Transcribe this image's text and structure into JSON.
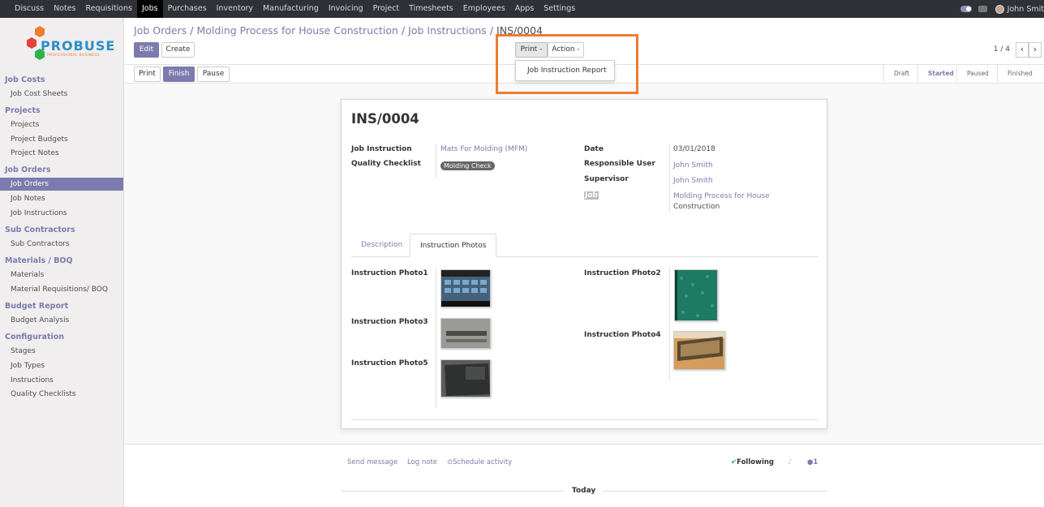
{
  "topnav": {
    "menu": [
      "Discuss",
      "Notes",
      "Requisitions",
      "Jobs",
      "Purchases",
      "Inventory",
      "Manufacturing",
      "Invoicing",
      "Project",
      "Timesheets",
      "Employees",
      "Apps",
      "Settings"
    ],
    "active": "Jobs",
    "user": "John Smit"
  },
  "logo": {
    "text": "PROBUSE",
    "tagline": "PROFESSIONAL BUSINESS"
  },
  "sidebar": {
    "sections": [
      {
        "title": "Job Costs",
        "items": [
          "Job Cost Sheets"
        ]
      },
      {
        "title": "Projects",
        "items": [
          "Projects",
          "Project Budgets",
          "Project Notes"
        ]
      },
      {
        "title": "Job Orders",
        "items": [
          "Job Orders",
          "Job Notes",
          "Job Instructions"
        ]
      },
      {
        "title": "Sub Contractors",
        "items": [
          "Sub Contractors"
        ]
      },
      {
        "title": "Materials / BOQ",
        "items": [
          "Materials",
          "Material Requisitions/ BOQ"
        ]
      },
      {
        "title": "Budget Report",
        "items": [
          "Budget Analysis"
        ]
      },
      {
        "title": "Configuration",
        "items": [
          "Stages",
          "Job Types",
          "Instructions",
          "Quality Checklists"
        ]
      }
    ],
    "active_item": "Job Orders"
  },
  "breadcrumb": {
    "items": [
      "Job Orders",
      "Molding Process for House Construction",
      "Job Instructions"
    ],
    "current": "INS/0004",
    "sep": "/"
  },
  "buttons": {
    "edit": "Edit",
    "create": "Create",
    "print": "Print -",
    "action": "Action -",
    "print_small": "Print",
    "finish": "Finish",
    "pause": "Pause"
  },
  "pager": {
    "value": "1 / 4",
    "prev": "‹",
    "next": "›"
  },
  "dropdown": {
    "items": [
      "Job Instruction Report"
    ]
  },
  "status": {
    "stages": [
      "Draft",
      "Started",
      "Paused",
      "Finished"
    ],
    "active": "Started"
  },
  "form": {
    "title": "INS/0004",
    "labels": {
      "job_instruction": "Job Instruction",
      "quality_checklist": "Quality Checklist",
      "date": "Date",
      "responsible_user": "Responsible User",
      "supervisor": "Supervisor",
      "job": "Job"
    },
    "values": {
      "job_instruction": "Mats For Molding (MFM)",
      "quality_checklist": "Molding Check",
      "date": "03/01/2018",
      "responsible_user": "John Smith",
      "supervisor": "John Smith",
      "job_line1": "Molding Process for House",
      "job_line2": "Construction"
    },
    "tabs": [
      "Description",
      "Instruction Photos"
    ],
    "active_tab": "Instruction Photos",
    "photos": [
      "Instruction Photo1",
      "Instruction Photo2",
      "Instruction Photo3",
      "Instruction Photo4",
      "Instruction Photo5"
    ]
  },
  "chatter": {
    "send_message": "Send message",
    "log_note": "Log note",
    "schedule_activity": "Schedule activity",
    "following": "Following",
    "followers": "1",
    "today": "Today"
  },
  "colors": {
    "accent": "#7c7bad",
    "highlight": "#ee7d31",
    "nav_bg": "#2f3136"
  }
}
